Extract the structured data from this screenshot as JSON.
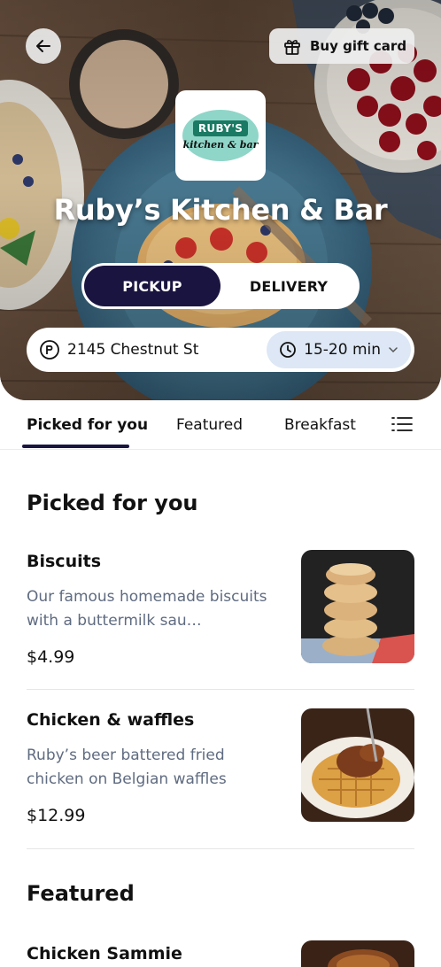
{
  "hero": {
    "back_icon": "arrow-left-icon",
    "gift_icon": "gift-icon",
    "gift_label": "Buy gift card",
    "logo": {
      "top_text": "RUBY'S",
      "bottom_text": "kitchen & bar",
      "accent": "#1a7a63",
      "oval": "#8fd6c8"
    },
    "title": "Ruby’s Kitchen & Bar"
  },
  "order_mode": {
    "options": [
      "PICKUP",
      "DELIVERY"
    ],
    "selected": "PICKUP",
    "active_color": "#1a1440"
  },
  "location": {
    "pin_icon": "map-pin-icon",
    "address": "2145 Chestnut St",
    "clock_icon": "clock-icon",
    "time": "15-20 min",
    "chevron_icon": "chevron-down-icon"
  },
  "tabs": {
    "items": [
      "Picked for you",
      "Featured",
      "Breakfast"
    ],
    "active": "Picked for you",
    "menu_icon": "list-menu-icon"
  },
  "sections": [
    {
      "title": "Picked for you",
      "items": [
        {
          "name": "Biscuits",
          "description": "Our famous homemade biscuits with a buttermilk sau…",
          "price": "$4.99",
          "image": "biscuit-stack-photo"
        },
        {
          "name": "Chicken & waffles",
          "description": "Ruby’s beer battered fried chicken on Belgian waffles",
          "price": "$12.99",
          "image": "chicken-waffles-photo"
        }
      ]
    },
    {
      "title": "Featured",
      "items": [
        {
          "name": "Chicken Sammie",
          "image": "chicken-sammie-photo"
        }
      ]
    }
  ]
}
